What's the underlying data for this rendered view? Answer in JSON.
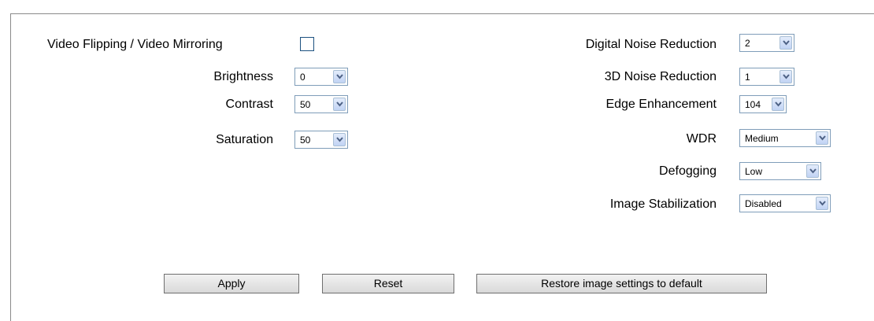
{
  "left": {
    "flip_label": "Video Flipping / Video Mirroring",
    "flip_checked": false,
    "brightness": {
      "label": "Brightness",
      "value": "0"
    },
    "contrast": {
      "label": "Contrast",
      "value": "50"
    },
    "saturation": {
      "label": "Saturation",
      "value": "50"
    }
  },
  "right": {
    "dnr": {
      "label": "Digital Noise Reduction",
      "value": "2"
    },
    "nr3d": {
      "label": "3D Noise Reduction",
      "value": "1"
    },
    "edge": {
      "label": "Edge Enhancement",
      "value": "104"
    },
    "wdr": {
      "label": "WDR",
      "value": "Medium"
    },
    "defog": {
      "label": "Defogging",
      "value": "Low"
    },
    "stab": {
      "label": "Image Stabilization",
      "value": "Disabled"
    }
  },
  "buttons": {
    "apply": "Apply",
    "reset": "Reset",
    "restore": "Restore image settings to default"
  },
  "icons": {
    "dropdown_arrow": "chevron-down-icon"
  },
  "colors": {
    "border": "#7f9db9",
    "arrow": "#4d6185"
  }
}
